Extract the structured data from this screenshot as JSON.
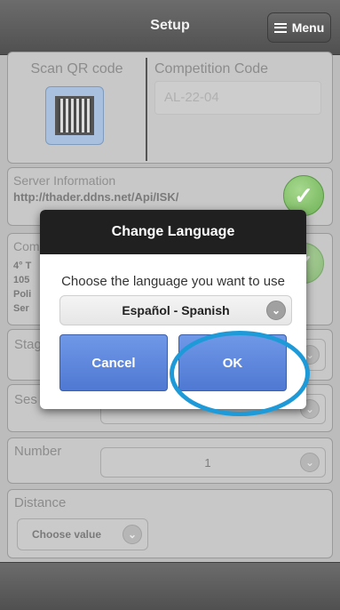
{
  "header": {
    "title": "Setup",
    "menu_label": "Menu"
  },
  "qr": {
    "label": "Scan QR code"
  },
  "competition": {
    "label": "Competition Code",
    "placeholder": "AL-22-04"
  },
  "server": {
    "label": "Server Information",
    "url": "http://thader.ddns.net/Api/ISK/"
  },
  "competitor": {
    "label_partial": "Com",
    "lines": [
      "4° T",
      "105",
      "Poli",
      "Ser"
    ]
  },
  "stage": {
    "label_partial": "Stag"
  },
  "session": {
    "label_partial": "Ses"
  },
  "number": {
    "label": "Number",
    "value": "1"
  },
  "distance": {
    "label": "Distance",
    "value": "Choose value"
  },
  "dialog": {
    "title": "Change Language",
    "prompt": "Choose the language you want to use",
    "selected_language": "Español - Spanish",
    "cancel_label": "Cancel",
    "ok_label": "OK"
  },
  "colors": {
    "accent": "#5b87de",
    "highlight": "#1f9ad8",
    "check": "#7cc062"
  },
  "icons": [
    "hamburger-icon",
    "qr-code-icon",
    "check-icon",
    "chevron-down-icon"
  ]
}
